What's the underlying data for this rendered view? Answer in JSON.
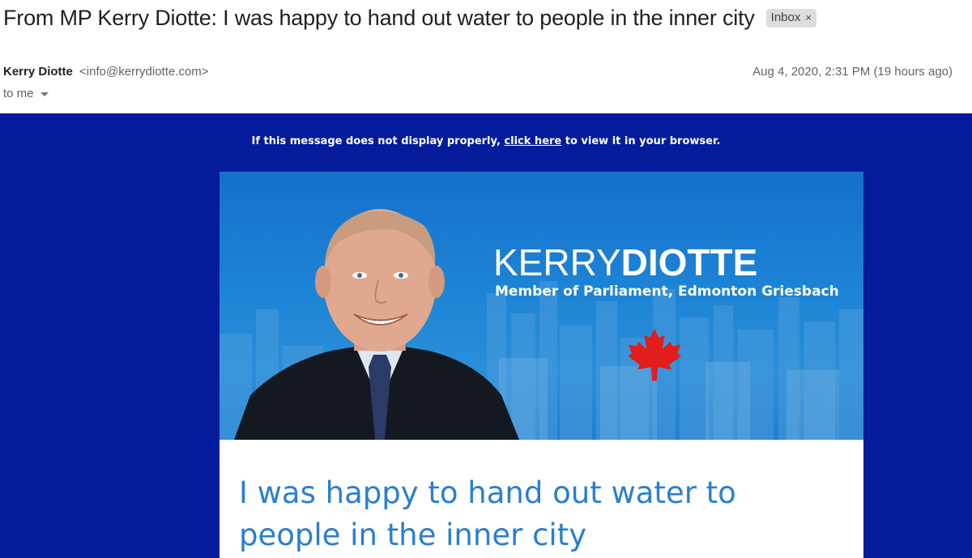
{
  "header": {
    "subject": "From MP Kerry Diotte: I was happy to hand out water to people in the inner city",
    "label": "Inbox",
    "label_close": "×"
  },
  "sender": {
    "name": "Kerry Diotte",
    "email": "<info@kerrydiotte.com>",
    "to": "to me",
    "date": "Aug 4, 2020, 2:31 PM (19 hours ago)"
  },
  "email": {
    "notice_before": "If this message does not display properly,",
    "notice_link": "click here",
    "notice_after": "to view it in your browser.",
    "brand_first": "KERRY",
    "brand_last": "DIOTTE",
    "brand_sub": "Member of Parliament, Edmonton Griesbach",
    "headline": "I was happy to hand out water to people in the inner city",
    "colors": {
      "body_bg": "#041c9c",
      "banner_blue": "#1d84d6",
      "headline": "#2a7fd0",
      "maple": "#e31c1c"
    },
    "icons": [
      "maple-leaf-icon",
      "chevron-down-icon",
      "close-icon"
    ]
  }
}
